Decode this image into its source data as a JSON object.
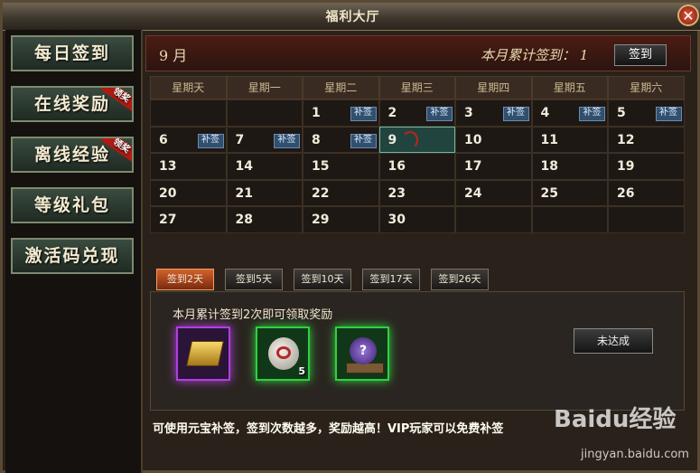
{
  "window": {
    "title": "福利大厅"
  },
  "sidebar": {
    "items": [
      {
        "label": "每日签到"
      },
      {
        "label": "在线奖励",
        "ribbon": "领奖"
      },
      {
        "label": "离线经验",
        "ribbon": "领奖"
      },
      {
        "label": "等级礼包"
      },
      {
        "label": "激活码兑现"
      }
    ]
  },
  "header": {
    "month": "9 月",
    "total_label": "本月累计签到：",
    "total_value": "1",
    "sign_button": "签到"
  },
  "calendar": {
    "weekdays": [
      "星期天",
      "星期一",
      "星期二",
      "星期三",
      "星期四",
      "星期五",
      "星期六"
    ],
    "makeup_label": "补签",
    "today": "9",
    "weeks": [
      [
        {
          "d": ""
        },
        {
          "d": ""
        },
        {
          "d": "1",
          "bq": true
        },
        {
          "d": "2",
          "bq": true
        },
        {
          "d": "3",
          "bq": true
        },
        {
          "d": "4",
          "bq": true
        },
        {
          "d": "5",
          "bq": true
        }
      ],
      [
        {
          "d": "6",
          "bq": true
        },
        {
          "d": "7",
          "bq": true
        },
        {
          "d": "8",
          "bq": true
        },
        {
          "d": "9",
          "today": true
        },
        {
          "d": "10"
        },
        {
          "d": "11"
        },
        {
          "d": "12"
        }
      ],
      [
        {
          "d": "13"
        },
        {
          "d": "14"
        },
        {
          "d": "15"
        },
        {
          "d": "16"
        },
        {
          "d": "17"
        },
        {
          "d": "18"
        },
        {
          "d": "19"
        }
      ],
      [
        {
          "d": "20"
        },
        {
          "d": "21"
        },
        {
          "d": "22"
        },
        {
          "d": "23"
        },
        {
          "d": "24"
        },
        {
          "d": "25"
        },
        {
          "d": "26"
        }
      ],
      [
        {
          "d": "27"
        },
        {
          "d": "28"
        },
        {
          "d": "29"
        },
        {
          "d": "30"
        },
        {
          "d": ""
        },
        {
          "d": ""
        },
        {
          "d": ""
        }
      ]
    ]
  },
  "tabs": [
    {
      "label": "签到2天",
      "active": true
    },
    {
      "label": "签到5天"
    },
    {
      "label": "签到10天"
    },
    {
      "label": "签到17天"
    },
    {
      "label": "签到26天"
    }
  ],
  "reward": {
    "title": "本月累计签到2次即可领取奖励",
    "items": [
      {
        "icon": "gold-ingot-icon",
        "color": "#b040e0",
        "qty": ""
      },
      {
        "icon": "jade-orb-icon",
        "color": "#30d040",
        "qty": "5"
      },
      {
        "icon": "mystery-box-icon",
        "color": "#30d040",
        "qty": ""
      }
    ],
    "status_button": "未达成"
  },
  "hint": "可使用元宝补签，签到次数越多，奖励越高！VIP玩家可以免费补签",
  "watermark": {
    "text": "Baidu经验",
    "sub": "jingyan.baidu.com"
  }
}
